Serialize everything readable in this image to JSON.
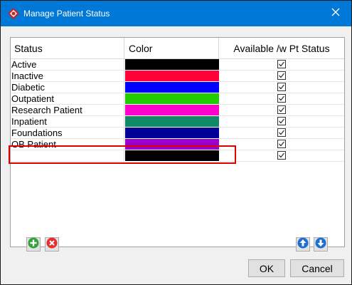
{
  "window": {
    "title": "Manage Patient Status",
    "titlebar_color": "#0078d7"
  },
  "table": {
    "headers": {
      "status": "Status",
      "color": "Color",
      "available": "Available /w Pt Status"
    },
    "rows": [
      {
        "status": "Active",
        "color": "#000000",
        "available": true
      },
      {
        "status": "Inactive",
        "color": "#ff0038",
        "available": true
      },
      {
        "status": "Diabetic",
        "color": "#0000ff",
        "available": true
      },
      {
        "status": "Outpatient",
        "color": "#22cc00",
        "available": true
      },
      {
        "status": "Research Patient",
        "color": "#ff00cc",
        "available": true
      },
      {
        "status": "Inpatient",
        "color": "#118866",
        "available": true
      },
      {
        "status": "Foundations",
        "color": "#000099",
        "available": true
      },
      {
        "status": "OB Patient",
        "color": "#9900cc",
        "available": true
      },
      {
        "status": "",
        "color": "#000000",
        "available": true
      }
    ]
  },
  "icons": {
    "title": "red-diamond-icon",
    "close": "close-icon",
    "add": "add-icon",
    "delete": "delete-icon",
    "up": "arrow-up-icon",
    "down": "arrow-down-icon"
  },
  "buttons": {
    "ok": "OK",
    "cancel": "Cancel"
  }
}
